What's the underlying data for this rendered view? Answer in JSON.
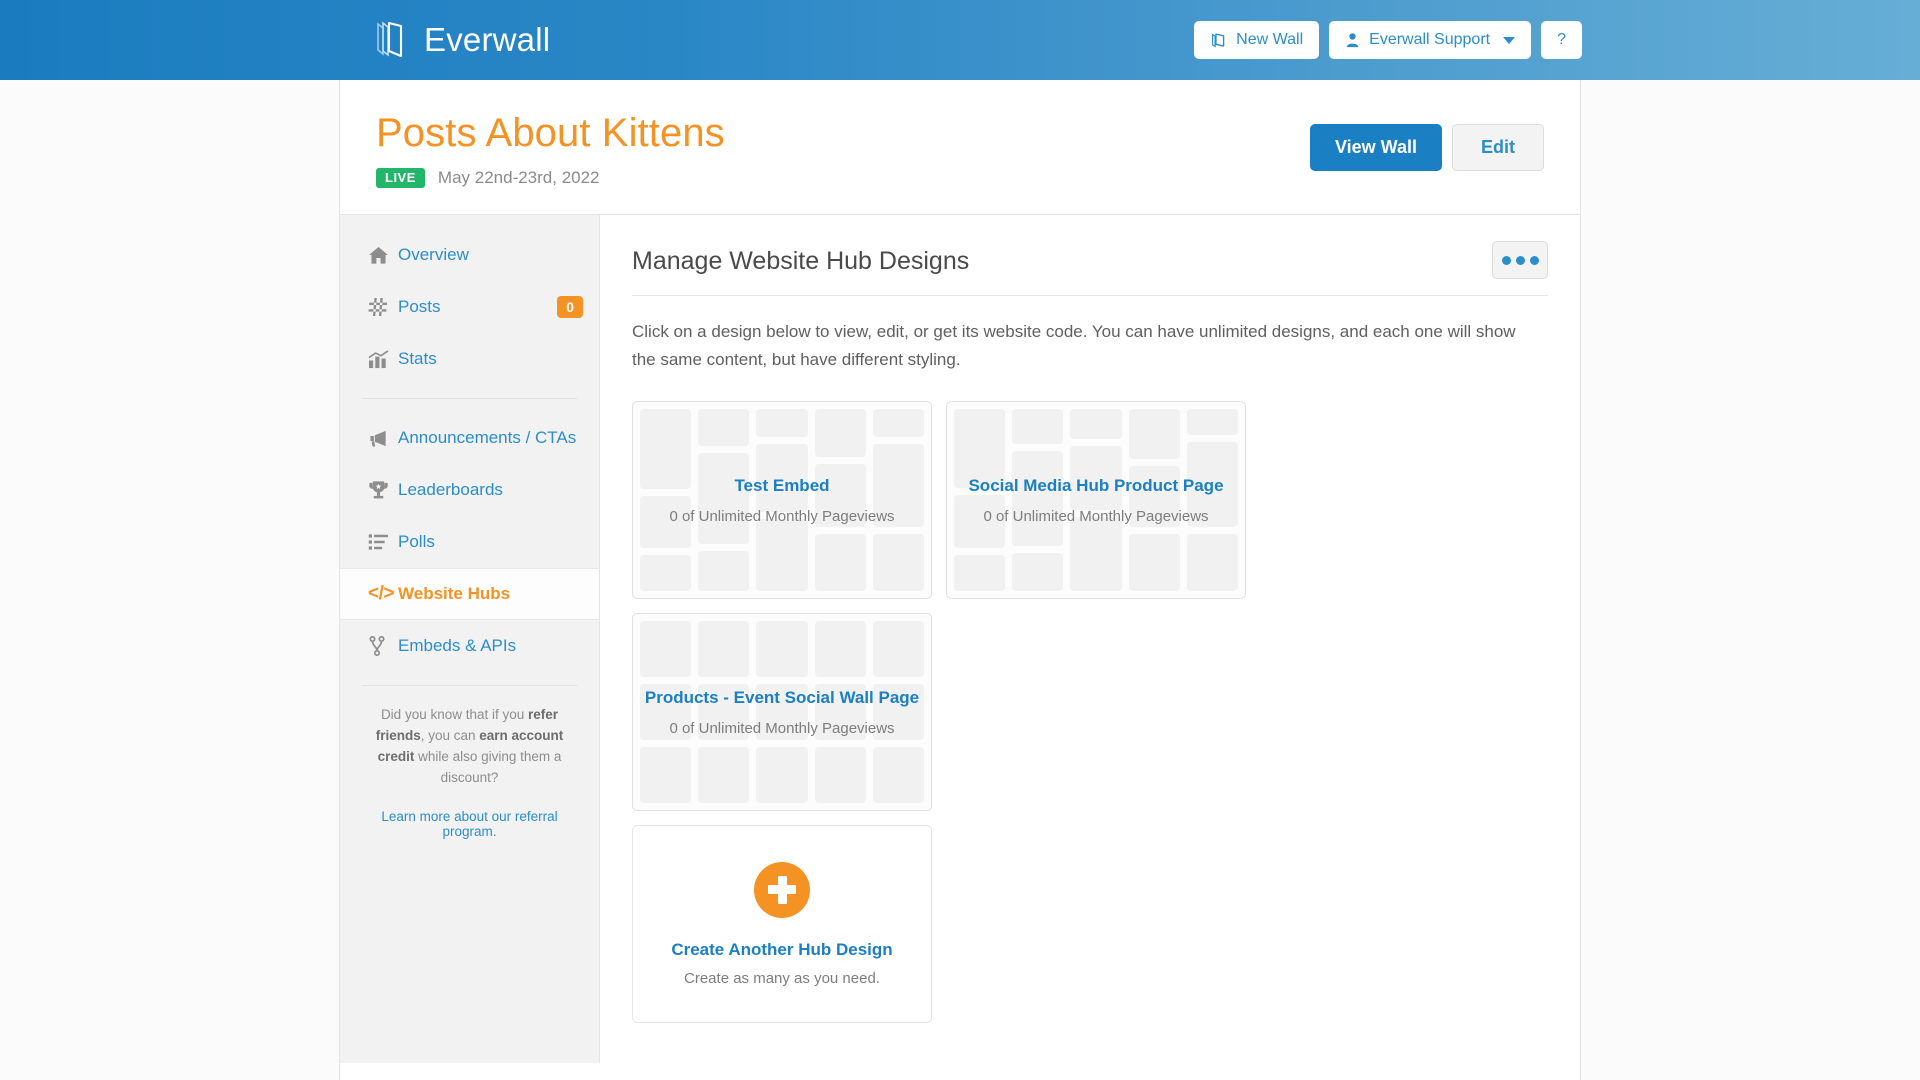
{
  "topbar": {
    "brand_name": "Everwall",
    "brand_logo_icon": "everwall-book-logo-icon",
    "new_wall_label": "New Wall",
    "new_wall_icon": "book-icon",
    "account_label": "Everwall Support",
    "account_icon": "user-icon",
    "account_caret_icon": "chevron-down-icon",
    "help_label": "?"
  },
  "wall": {
    "title": "Posts About Kittens",
    "status_badge": "LIVE",
    "date_range": "May 22nd-23rd, 2022",
    "view_wall_label": "View Wall",
    "edit_label": "Edit"
  },
  "sidebar": {
    "groups": [
      {
        "items": [
          {
            "label": "Overview",
            "icon": "home-icon",
            "badge": null,
            "active": false
          },
          {
            "label": "Posts",
            "icon": "hashtag-icon",
            "badge": "0",
            "active": false
          },
          {
            "label": "Stats",
            "icon": "bar-chart-icon",
            "badge": null,
            "active": false
          }
        ]
      },
      {
        "items": [
          {
            "label": "Announcements / CTAs",
            "icon": "megaphone-icon",
            "badge": null,
            "active": false
          },
          {
            "label": "Leaderboards",
            "icon": "trophy-icon",
            "badge": null,
            "active": false
          },
          {
            "label": "Polls",
            "icon": "list-icon",
            "badge": null,
            "active": false
          },
          {
            "label": "Website Hubs",
            "icon": "code-icon",
            "badge": null,
            "active": true
          },
          {
            "label": "Embeds & APIs",
            "icon": "branch-icon",
            "badge": null,
            "active": false
          }
        ]
      }
    ],
    "referral": {
      "line1_a": "Did you know that if you ",
      "line1_b": "refer friends",
      "line1_c": ", you can ",
      "line1_d": "earn account credit",
      "line1_e": " while also giving them a discount?",
      "link": "Learn more about our referral program."
    }
  },
  "main": {
    "heading": "Manage Website Hub Designs",
    "more_icon": "ellipsis-icon",
    "description": "Click on a design below to view, edit, or get its website code. You can have unlimited designs, and each one will show the same content, but have different styling.",
    "designs": [
      {
        "title": "Test Embed",
        "pageviews": "0 of Unlimited Monthly Pageviews",
        "pattern": "masonry"
      },
      {
        "title": "Social Media Hub Product Page",
        "pageviews": "0 of Unlimited Monthly Pageviews",
        "pattern": "masonry"
      },
      {
        "title": "Products - Event Social Wall Page",
        "pageviews": "0 of Unlimited Monthly Pageviews",
        "pattern": "grid"
      }
    ],
    "create_card": {
      "icon": "plus-circle-icon",
      "title": "Create Another Hub Design",
      "subtitle": "Create as many as you need."
    }
  },
  "colors": {
    "brand_blue": "#1b7fc4",
    "accent_orange": "#f49324",
    "live_green": "#22b66b",
    "link_blue": "#2b8dcc"
  }
}
